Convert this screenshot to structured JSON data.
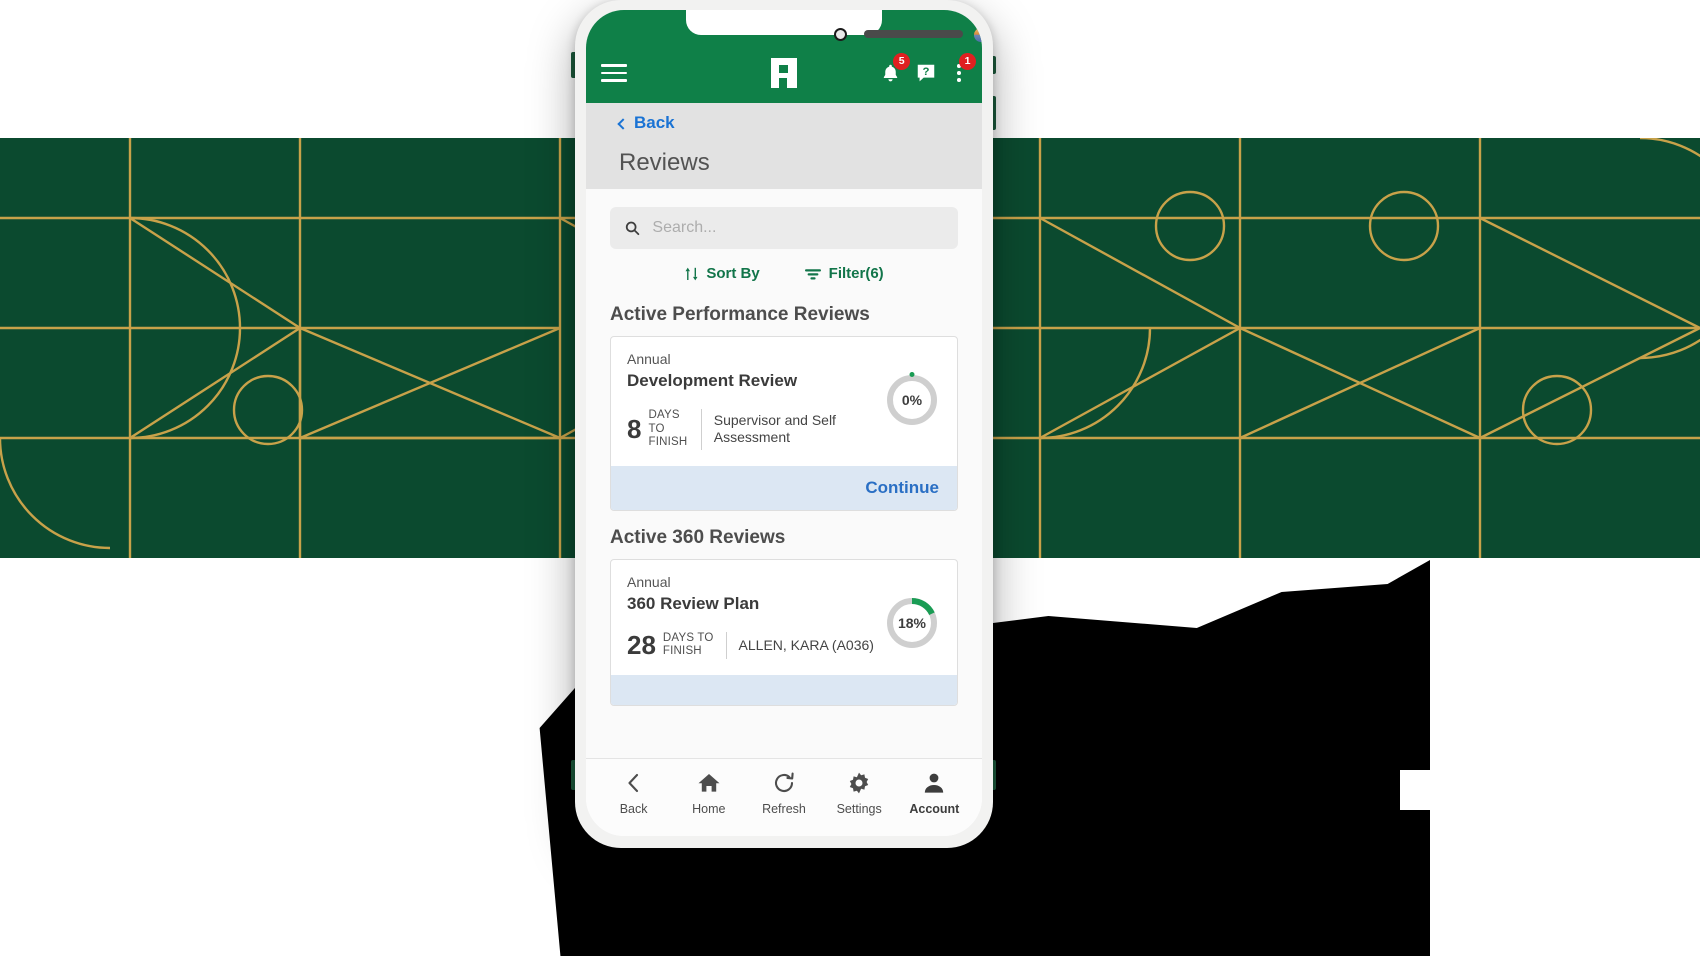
{
  "theme": {
    "brand_green": "#0f8048",
    "badge_red": "#e02020",
    "link_blue": "#1a73d4",
    "action_blue": "#2a6fc4",
    "background_dark_green": "#0b4a2f",
    "background_line_gold": "#c8a24a"
  },
  "appbar": {
    "menu_icon": "hamburger-menu-icon",
    "logo_icon": "paycom-logo-icon",
    "notifications": {
      "icon": "bell-icon",
      "badge": "5"
    },
    "help": {
      "icon": "help-question-icon"
    },
    "overflow": {
      "icon": "kebab-menu-icon",
      "badge": "1"
    }
  },
  "header": {
    "back_label": "Back",
    "title": "Reviews"
  },
  "search": {
    "icon": "search-icon",
    "value": "",
    "placeholder": "Search..."
  },
  "tools": {
    "sort": {
      "icon": "sort-arrows-icon",
      "label": "Sort By"
    },
    "filter": {
      "icon": "filter-funnel-icon",
      "label": "Filter(6)"
    }
  },
  "sections": [
    {
      "title": "Active Performance Reviews",
      "cards": [
        {
          "type": "Annual",
          "name": "Development Review",
          "days_value": "8",
          "days_label_line1": "DAYS TO",
          "days_label_line2": "FINISH",
          "meta": "Supervisor and Self Assessment",
          "progress_pct": 0,
          "progress_text": "0%",
          "action_label": "Continue"
        }
      ]
    },
    {
      "title": "Active 360 Reviews",
      "cards": [
        {
          "type": "Annual",
          "name": "360 Review Plan",
          "days_value": "28",
          "days_label_line1": "DAYS TO",
          "days_label_line2": "FINISH",
          "meta": "ALLEN, KARA (A036)",
          "progress_pct": 18,
          "progress_text": "18%",
          "action_label": ""
        }
      ]
    }
  ],
  "bottomnav": [
    {
      "icon": "chevron-left-icon",
      "label": "Back"
    },
    {
      "icon": "home-icon",
      "label": "Home"
    },
    {
      "icon": "refresh-icon",
      "label": "Refresh"
    },
    {
      "icon": "gear-icon",
      "label": "Settings"
    },
    {
      "icon": "person-icon",
      "label": "Account"
    }
  ]
}
